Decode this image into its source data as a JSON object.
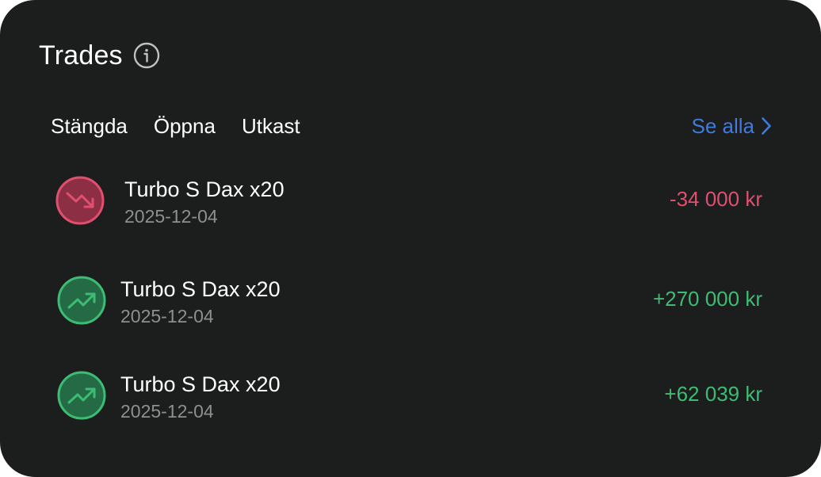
{
  "widget": {
    "title": "Trades"
  },
  "tabs": [
    {
      "label": "Stängda"
    },
    {
      "label": "Öppna"
    },
    {
      "label": "Utkast"
    }
  ],
  "see_all": {
    "label": "Se alla"
  },
  "colors": {
    "background": "#1c1d1d",
    "loss": "#e0506e",
    "gain": "#3dbd73",
    "link": "#3d7be0",
    "muted": "#8e8f8f"
  },
  "trades": [
    {
      "name": "Turbo S Dax x20",
      "date": "2025-12-04",
      "amount": "-34 000 kr",
      "direction": "down",
      "icon": "trending-down-icon"
    },
    {
      "name": "Turbo S Dax x20",
      "date": "2025-12-04",
      "amount": "+270 000 kr",
      "direction": "up",
      "icon": "trending-up-icon"
    },
    {
      "name": "Turbo S Dax x20",
      "date": "2025-12-04",
      "amount": "+62 039 kr",
      "direction": "up",
      "icon": "trending-up-icon"
    }
  ]
}
